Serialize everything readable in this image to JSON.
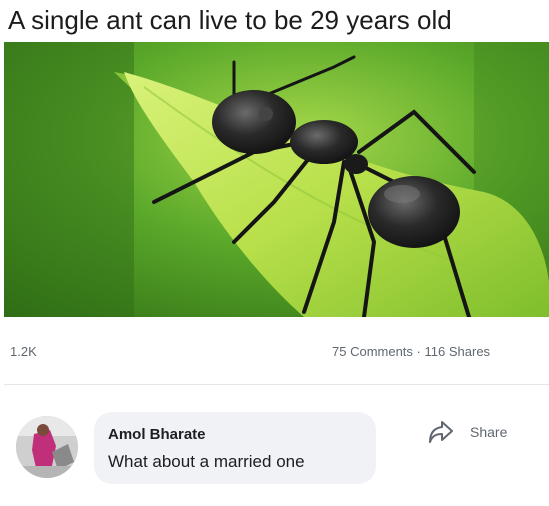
{
  "post": {
    "title": "A single ant can live to be 29 years old",
    "photo_description": "ant-on-leaf-photo"
  },
  "stats": {
    "reactions": "1.2K",
    "comments": "75 Comments",
    "separator": "·",
    "shares": "116 Shares"
  },
  "comment": {
    "author": "Amol Bharate",
    "text": "What about a married one"
  },
  "share_button": {
    "label": "Share"
  },
  "colors": {
    "background": "#ffffff",
    "bubble": "#f0f2f5",
    "muted_text": "#606770",
    "photo_green": "#5aa82a"
  }
}
